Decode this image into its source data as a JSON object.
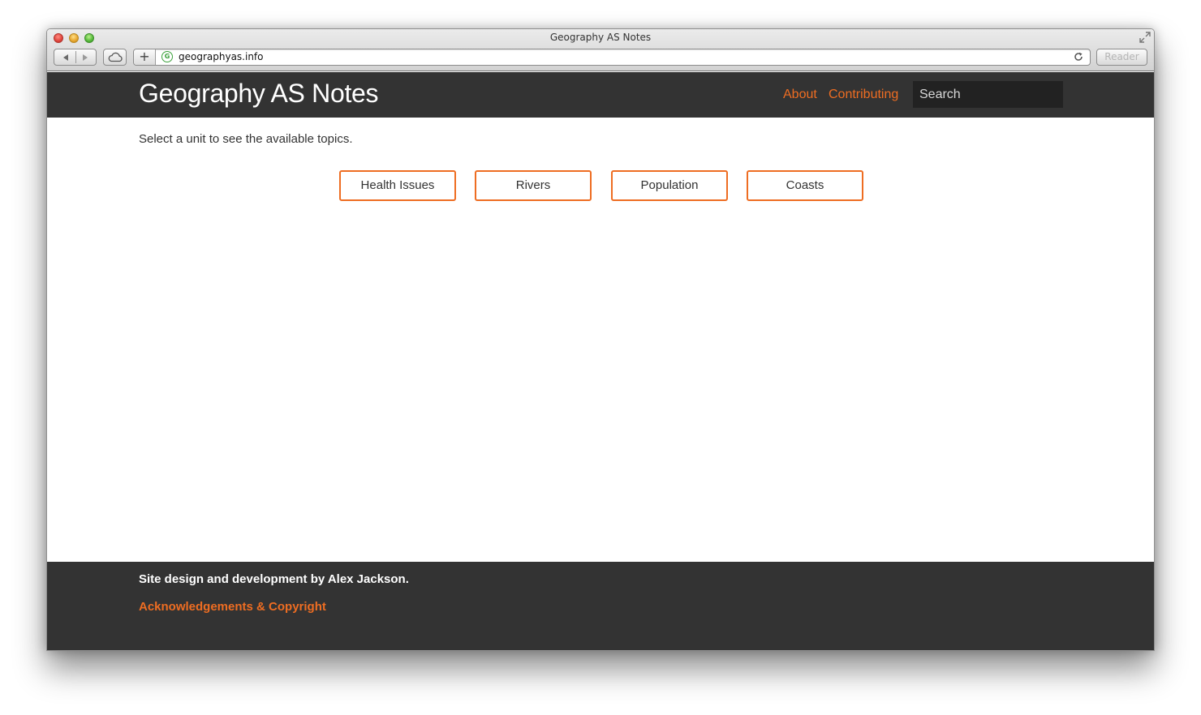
{
  "browser": {
    "window_title": "Geography AS Notes",
    "url": "geographyas.info",
    "site_icon_letter": "G",
    "new_tab_glyph": "+",
    "reader_label": "Reader",
    "icons": [
      "close-icon",
      "minimize-icon",
      "zoom-icon",
      "fullscreen-icon",
      "back-icon",
      "forward-icon",
      "icloud-icon",
      "reload-icon"
    ]
  },
  "header": {
    "brand": "Geography AS Notes",
    "nav": [
      {
        "label": "About"
      },
      {
        "label": "Contributing"
      }
    ],
    "search": {
      "placeholder": "Search",
      "value": ""
    }
  },
  "main": {
    "intro": "Select a unit to see the available topics.",
    "units": [
      {
        "label": "Health Issues"
      },
      {
        "label": "Rivers"
      },
      {
        "label": "Population"
      },
      {
        "label": "Coasts"
      }
    ]
  },
  "footer": {
    "credit": "Site design and development by Alex Jackson.",
    "link": "Acknowledgements & Copyright"
  },
  "colors": {
    "accent": "#ee6d22",
    "header_bg": "#333333",
    "search_bg": "#222222",
    "body_bg": "#ffffff",
    "text": "#333333"
  }
}
